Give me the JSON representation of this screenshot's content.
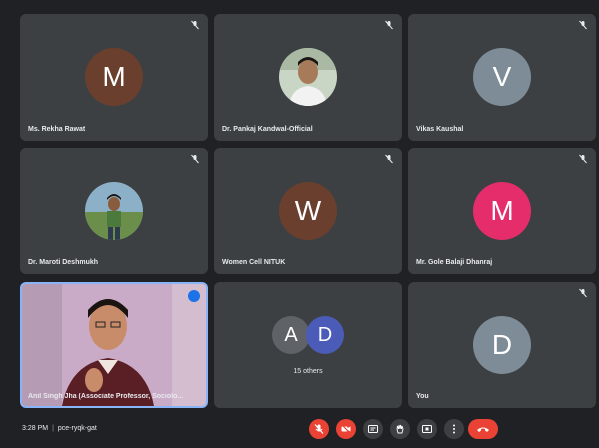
{
  "participants": [
    {
      "name": "Ms. Rekha Rawat",
      "initial": "M",
      "color": "#6b3f2e"
    },
    {
      "name": "Dr. Pankaj Kandwal-Official",
      "photo": true
    },
    {
      "name": "Vikas Kaushal",
      "initial": "V",
      "color": "#7d8c96"
    },
    {
      "name": "Dr. Maroti Deshmukh",
      "photo": true
    },
    {
      "name": "Women Cell NITUK",
      "initial": "W",
      "color": "#6b3f2e"
    },
    {
      "name": "Mr. Gole Balaji Dhanraj",
      "initial": "M",
      "color": "#e52d6b"
    },
    {
      "name": "Anil Singh Jha (Associate Professor, Sociolo...",
      "video": true
    },
    {
      "others_label": "15 others",
      "avatars": [
        {
          "initial": "A",
          "color": "#5f6368"
        },
        {
          "initial": "D",
          "color": "#4b5cb8"
        }
      ]
    },
    {
      "name": "You",
      "initial": "D",
      "color": "#7d8c96"
    }
  ],
  "meeting": {
    "time": "3:28 PM",
    "separator": "|",
    "code": "pce-ryqk-gat"
  },
  "icons": {
    "mic_off": "mic-off-icon",
    "camera_off": "camera-off-icon",
    "captions": "captions-icon",
    "raise_hand": "raise-hand-icon",
    "present": "present-icon",
    "more": "more-options-icon",
    "end_call": "end-call-icon"
  },
  "colors": {
    "tile_bg": "#3c4043",
    "page_bg": "#202124",
    "danger": "#ea4335",
    "speaking_border": "#8ab4f8"
  }
}
